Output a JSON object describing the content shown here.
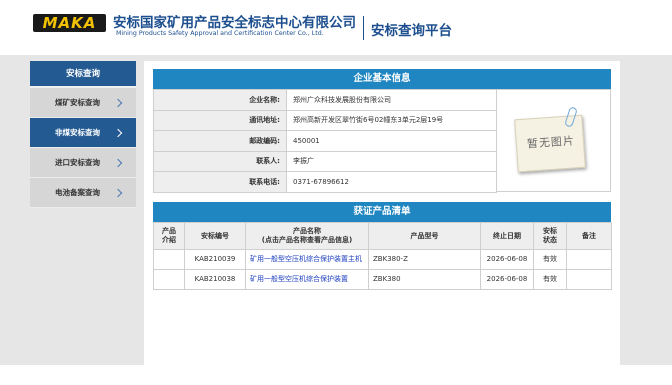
{
  "header": {
    "logo_text": "MAKA",
    "org_name_cn": "安标国家矿用产品安全标志中心有限公司",
    "org_name_en": "Mining Products Safety Approval and Certification Center Co., Ltd.",
    "platform_title": "安标查询平台"
  },
  "sidebar": {
    "title": "安标查询",
    "items": [
      {
        "label": "煤矿安标查询",
        "active": false
      },
      {
        "label": "非煤安标查询",
        "active": true
      },
      {
        "label": "进口安标查询",
        "active": false
      },
      {
        "label": "电池备案查询",
        "active": false
      }
    ]
  },
  "company": {
    "section_title": "企业基本信息",
    "rows": [
      {
        "label": "企业名称:",
        "value": "郑州广众科技发展股份有限公司"
      },
      {
        "label": "通讯地址:",
        "value": "郑州高新开发区翠竹街6号02幢东3单元2层19号"
      },
      {
        "label": "邮政编码:",
        "value": "450001"
      },
      {
        "label": "联系人:",
        "value": "李振广"
      },
      {
        "label": "联系电话:",
        "value": "0371-67896612"
      }
    ],
    "no_image_text": "暂无图片"
  },
  "products": {
    "section_title": "获证产品清单",
    "headers": {
      "intro_l1": "产品",
      "intro_l2": "介绍",
      "cert_no": "安标编号",
      "name_l1": "产品名称",
      "name_l2": "(点击产品名称查看产品信息)",
      "model": "产品型号",
      "end_date": "终止日期",
      "status_l1": "安标",
      "status_l2": "状态",
      "remark": "备注"
    },
    "rows": [
      {
        "intro": "",
        "cert_no": "KAB210039",
        "name": "矿用一般型空压机综合保护装置主机",
        "model": "ZBK380-Z",
        "end_date": "2026-06-08",
        "status": "有效",
        "remark": ""
      },
      {
        "intro": "",
        "cert_no": "KAB210038",
        "name": "矿用一般型空压机综合保护装置",
        "model": "ZBK380",
        "end_date": "2026-06-08",
        "status": "有效",
        "remark": ""
      }
    ]
  }
}
